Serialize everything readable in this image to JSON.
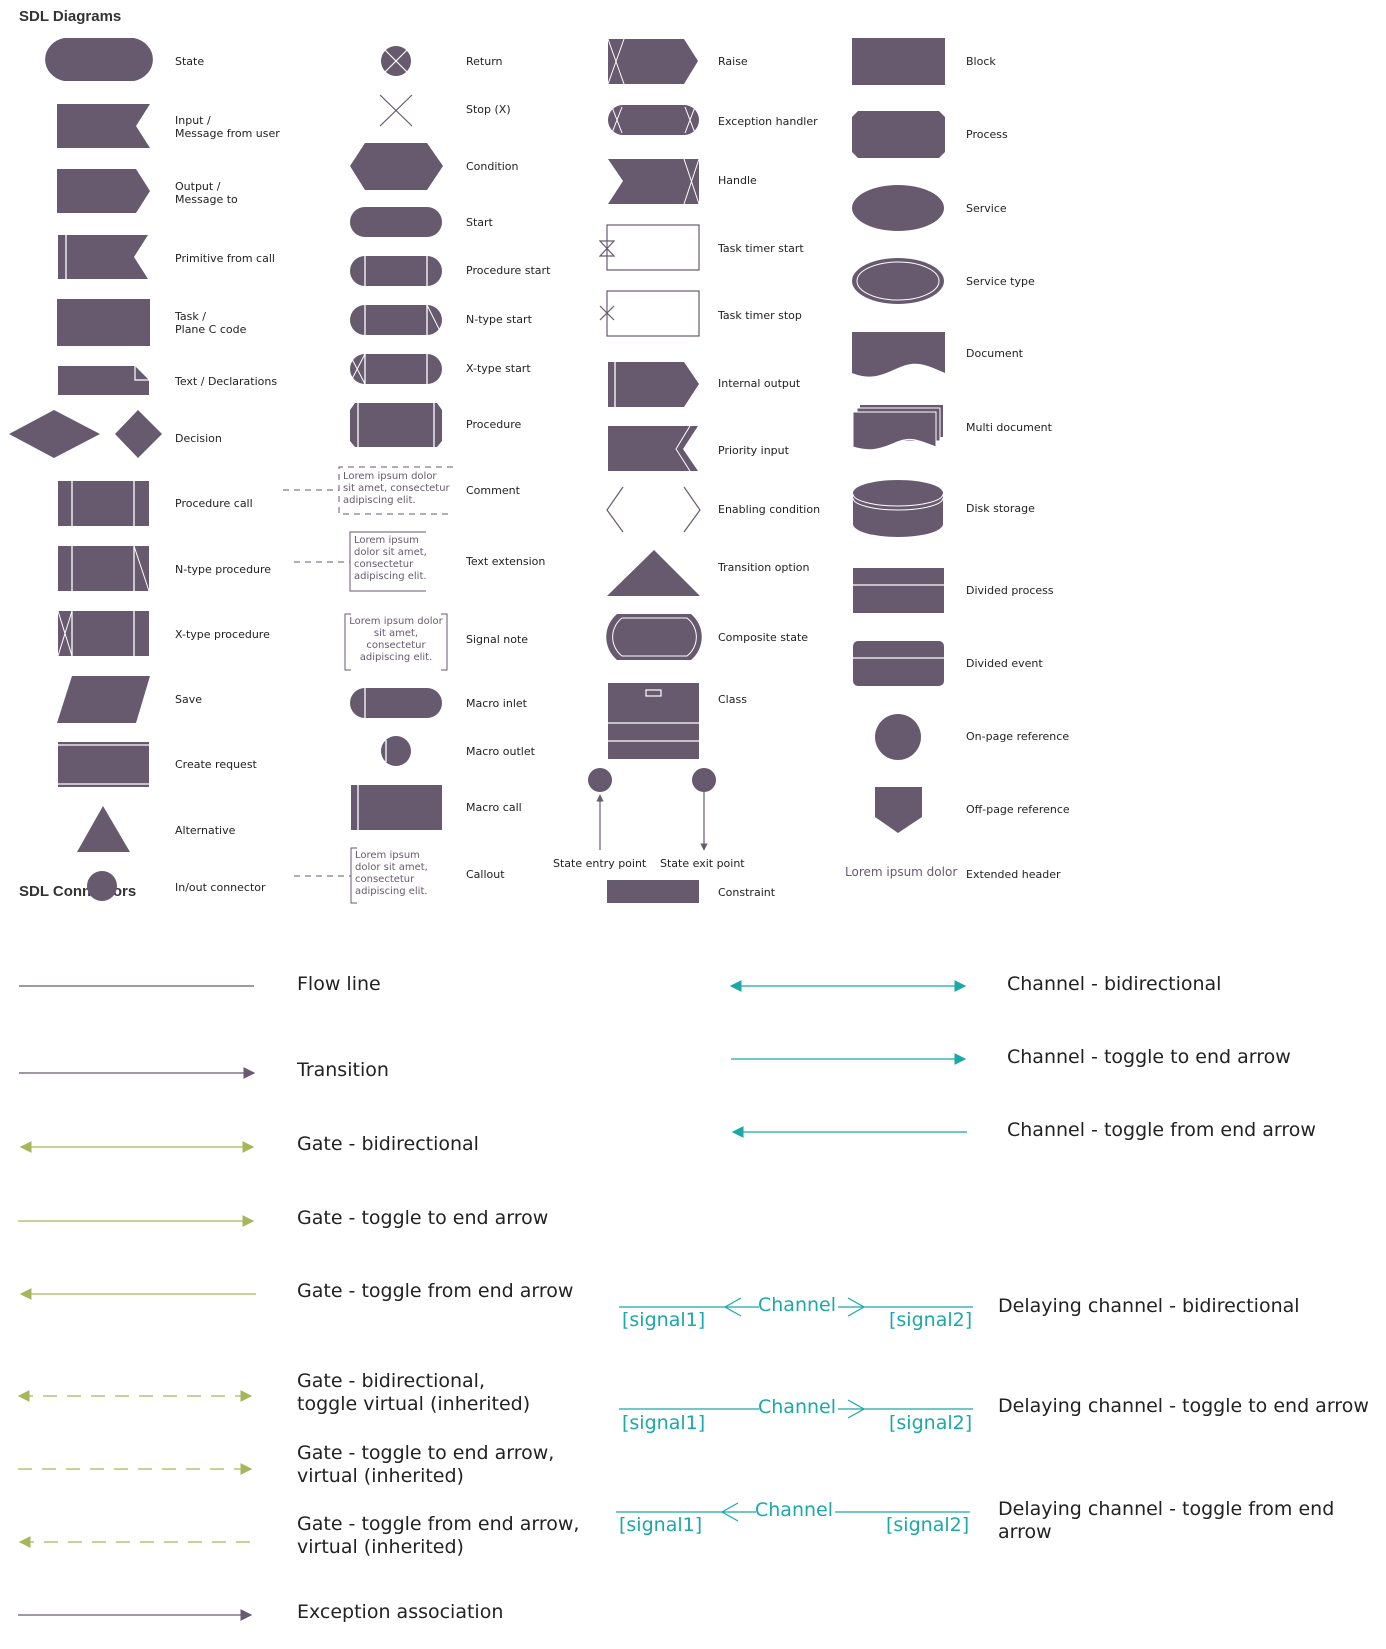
{
  "colors": {
    "shape_fill": "#675a6e",
    "gate": "#a9b55a",
    "channel": "#1aa8a8",
    "text": "#222222",
    "note_text": "#675a6e"
  },
  "diagrams": {
    "title": "SDL Diagrams",
    "col1": [
      {
        "label": "State",
        "shape": "state"
      },
      {
        "label": "Input /\nMessage from user",
        "shape": "input"
      },
      {
        "label": "Output /\nMessage to",
        "shape": "output"
      },
      {
        "label": "Primitive from call",
        "shape": "primitive-from-call"
      },
      {
        "label": "Task /\nPlane C code",
        "shape": "task"
      },
      {
        "label": "Text / Declarations",
        "shape": "text-declarations"
      },
      {
        "label": "Decision",
        "shape": "decision"
      },
      {
        "label": "Procedure call",
        "shape": "procedure-call"
      },
      {
        "label": "N-type procedure",
        "shape": "n-type-procedure"
      },
      {
        "label": "X-type procedure",
        "shape": "x-type-procedure"
      },
      {
        "label": "Save",
        "shape": "save"
      },
      {
        "label": "Create request",
        "shape": "create-request"
      },
      {
        "label": "Alternative",
        "shape": "alternative"
      },
      {
        "label": "In/out connector",
        "shape": "in-out-connector"
      }
    ],
    "col2": [
      {
        "label": "Return",
        "shape": "return"
      },
      {
        "label": "Stop (X)",
        "shape": "stop"
      },
      {
        "label": "Condition",
        "shape": "condition"
      },
      {
        "label": "Start",
        "shape": "start"
      },
      {
        "label": "Procedure start",
        "shape": "procedure-start"
      },
      {
        "label": "N-type start",
        "shape": "n-type-start"
      },
      {
        "label": "X-type start",
        "shape": "x-type-start"
      },
      {
        "label": "Procedure",
        "shape": "procedure"
      },
      {
        "label": "Comment",
        "shape": "comment",
        "note": "Lorem ipsum dolor\nsit amet, consectetur\nadipiscing elit."
      },
      {
        "label": "Text extension",
        "shape": "text-extension",
        "note": "Lorem ipsum\ndolor sit amet,\nconsectetur\nadipiscing elit."
      },
      {
        "label": "Signal note",
        "shape": "signal-note",
        "note": "Lorem ipsum dolor\nsit amet,\nconsectetur\nadipiscing elit."
      },
      {
        "label": "Macro inlet",
        "shape": "macro-inlet"
      },
      {
        "label": "Macro outlet",
        "shape": "macro-outlet"
      },
      {
        "label": "Macro call",
        "shape": "macro-call"
      },
      {
        "label": "Callout",
        "shape": "callout",
        "note": "Lorem ipsum\ndolor sit amet,\nconsectetur\nadipiscing elit."
      }
    ],
    "col3": [
      {
        "label": "Raise",
        "shape": "raise"
      },
      {
        "label": "Exception handler",
        "shape": "exception-handler"
      },
      {
        "label": "Handle",
        "shape": "handle"
      },
      {
        "label": "Task timer start",
        "shape": "task-timer-start"
      },
      {
        "label": "Task timer stop",
        "shape": "task-timer-stop"
      },
      {
        "label": "Internal output",
        "shape": "internal-output"
      },
      {
        "label": "Priority input",
        "shape": "priority-input"
      },
      {
        "label": "Enabling condition",
        "shape": "enabling-condition"
      },
      {
        "label": "Transition option",
        "shape": "transition-option"
      },
      {
        "label": "Composite state",
        "shape": "composite-state"
      },
      {
        "label": "Class",
        "shape": "class"
      },
      {
        "label": "State entry point",
        "shape": "state-entry-point"
      },
      {
        "label": "State exit point",
        "shape": "state-exit-point"
      },
      {
        "label": "Constraint",
        "shape": "constraint"
      }
    ],
    "col4": [
      {
        "label": "Block",
        "shape": "block"
      },
      {
        "label": "Process",
        "shape": "process"
      },
      {
        "label": "Service",
        "shape": "service"
      },
      {
        "label": "Service type",
        "shape": "service-type"
      },
      {
        "label": "Document",
        "shape": "document"
      },
      {
        "label": "Multi document",
        "shape": "multi-document"
      },
      {
        "label": "Disk storage",
        "shape": "disk-storage"
      },
      {
        "label": "Divided process",
        "shape": "divided-process"
      },
      {
        "label": "Divided event",
        "shape": "divided-event"
      },
      {
        "label": "On-page reference",
        "shape": "on-page-reference"
      },
      {
        "label": "Off-page reference",
        "shape": "off-page-reference"
      },
      {
        "label": "Extended header",
        "shape": "extended-header",
        "note": "Lorem ipsum dolor"
      }
    ]
  },
  "connectors": {
    "title": "SDL Connectors",
    "left": [
      {
        "label": "Flow line",
        "kind": "flow-line"
      },
      {
        "label": "Transition",
        "kind": "transition"
      },
      {
        "label": "Gate - bidirectional",
        "kind": "gate-bidirectional"
      },
      {
        "label": "Gate - toggle to end arrow",
        "kind": "gate-to-end"
      },
      {
        "label": "Gate - toggle from end arrow",
        "kind": "gate-from-end"
      },
      {
        "label": "Gate - bidirectional,\ntoggle virtual (inherited)",
        "kind": "gate-bidirectional-virtual"
      },
      {
        "label": "Gate - toggle to end arrow,\nvirtual (inherited)",
        "kind": "gate-to-end-virtual"
      },
      {
        "label": "Gate - toggle from end arrow,\nvirtual (inherited)",
        "kind": "gate-from-end-virtual"
      },
      {
        "label": "Exception association",
        "kind": "exception-association"
      }
    ],
    "right": [
      {
        "label": "Channel - bidirectional",
        "kind": "channel-bidirectional"
      },
      {
        "label": "Channel - toggle to end arrow",
        "kind": "channel-to-end"
      },
      {
        "label": "Channel - toggle from end arrow",
        "kind": "channel-from-end"
      }
    ],
    "delaying": [
      {
        "label": "Delaying channel - bidirectional",
        "channel": "Channel",
        "signal1": "[signal1]",
        "signal2": "[signal2]",
        "kind": "delaying-bidirectional"
      },
      {
        "label": "Delaying channel - toggle to end arrow",
        "channel": "Channel",
        "signal1": "[signal1]",
        "signal2": "[signal2]",
        "kind": "delaying-to-end"
      },
      {
        "label": "Delaying channel - toggle from end arrow",
        "channel": "Channel",
        "signal1": "[signal1]",
        "signal2": "[signal2]",
        "kind": "delaying-from-end"
      }
    ]
  }
}
